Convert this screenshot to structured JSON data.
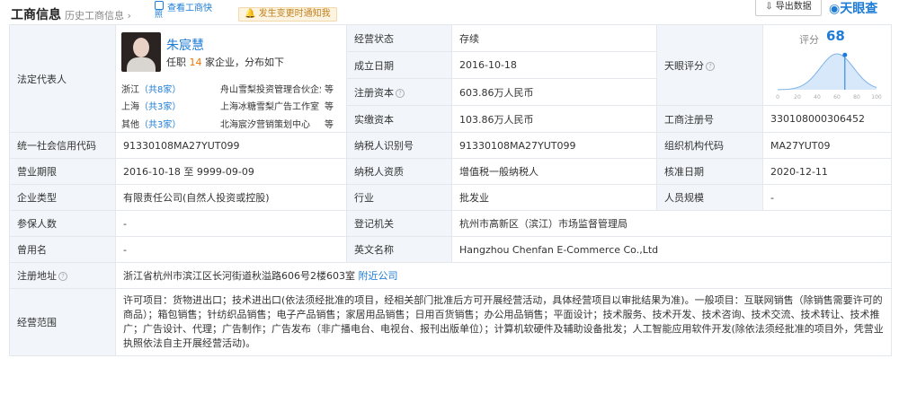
{
  "header": {
    "active_tab": "工商信息",
    "history_tab": "历史工商信息 ›",
    "view_button_line1": "查看工商快",
    "view_button_line2": "照",
    "notify_button": "发生变更时通知我",
    "export_button": "导出数据",
    "brand": "天眼查"
  },
  "legal_rep": {
    "label": "法定代表人",
    "name": "朱宸慧",
    "sub_prefix": "任职",
    "count": "14",
    "sub_suffix": "家企业，分布如下",
    "rows": [
      {
        "prov": "浙江",
        "count": "（共8家）",
        "co": "舟山雪梨投资管理合伙企业",
        "more": "等"
      },
      {
        "prov": "上海",
        "count": "（共3家）",
        "co": "上海冰糖雪梨广告工作室",
        "more": "等"
      },
      {
        "prov": "其他",
        "count": "（共3家）",
        "co": "北海宸汐营销策划中心",
        "more": "等"
      }
    ]
  },
  "fields": {
    "status_label": "经营状态",
    "status": "存续",
    "established_label": "成立日期",
    "established": "2016-10-18",
    "reg_capital_label": "注册资本",
    "reg_capital": "603.86万人民币",
    "paid_capital_label": "实缴资本",
    "paid_capital": "103.86万人民币",
    "tyc_score_label": "天眼评分",
    "reg_no_label": "工商注册号",
    "reg_no": "330108000306452",
    "credit_code_label": "统一社会信用代码",
    "credit_code": "91330108MA27YUT099",
    "tax_id_label": "纳税人识别号",
    "tax_id": "91330108MA27YUT099",
    "org_code_label": "组织机构代码",
    "org_code": "MA27YUT09",
    "term_label": "营业期限",
    "term": "2016-10-18 至 9999-09-09",
    "taxpayer_label": "纳税人资质",
    "taxpayer": "增值税一般纳税人",
    "approved_label": "核准日期",
    "approved": "2020-12-11",
    "type_label": "企业类型",
    "type": "有限责任公司(自然人投资或控股)",
    "industry_label": "行业",
    "industry": "批发业",
    "staff_label": "人员规模",
    "staff": "-",
    "insured_label": "参保人数",
    "insured": "-",
    "authority_label": "登记机关",
    "authority": "杭州市高新区（滨江）市场监督管理局",
    "former_label": "曾用名",
    "former": "-",
    "english_label": "英文名称",
    "english": "Hangzhou Chenfan E-Commerce Co.,Ltd",
    "address_label": "注册地址",
    "address": "浙江省杭州市滨江区长河街道秋溢路606号2楼603室",
    "nearby": "附近公司",
    "scope_label": "经营范围",
    "scope": "许可项目：货物进出口；技术进出口(依法须经批准的项目，经相关部门批准后方可开展经营活动，具体经营项目以审批结果为准)。一般项目：互联网销售（除销售需要许可的商品）；箱包销售；针纺织品销售；电子产品销售；家居用品销售；日用百货销售；办公用品销售；平面设计；技术服务、技术开发、技术咨询、技术交流、技术转让、技术推广；广告设计、代理；广告制作；广告发布（非广播电台、电视台、报刊出版单位）；计算机软硬件及辅助设备批发；人工智能应用软件开发(除依法须经批准的项目外，凭营业执照依法自主开展经营活动)。"
  },
  "score": {
    "label": "评分",
    "value": "68",
    "value_num": 68,
    "axis_ticks": [
      "0",
      "20",
      "40",
      "60",
      "80",
      "100"
    ],
    "accent": "#1e7cd6"
  }
}
